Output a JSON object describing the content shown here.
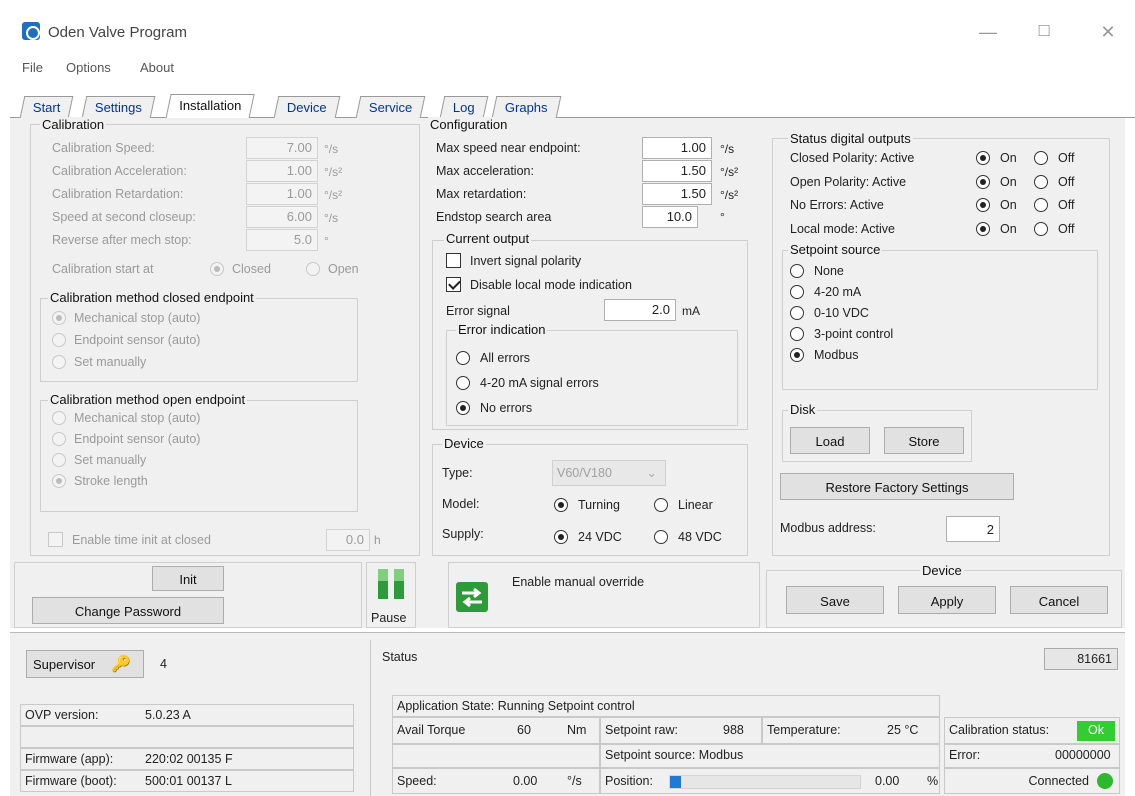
{
  "window": {
    "title": "Oden Valve Program",
    "minimize": "—",
    "maximize": "☐",
    "close": "✕"
  },
  "menu": {
    "file": "File",
    "options": "Options",
    "about": "About"
  },
  "tabs": [
    "Start",
    "Settings",
    "Installation",
    "Device",
    "Service",
    "Log",
    "Graphs"
  ],
  "active_tab": "Installation",
  "calibration": {
    "title": "Calibration",
    "rows": [
      {
        "label": "Calibration Speed:",
        "value": "7.00",
        "unit": "°/s"
      },
      {
        "label": "Calibration Acceleration:",
        "value": "1.00",
        "unit": "°/s²"
      },
      {
        "label": "Calibration Retardation:",
        "value": "1.00",
        "unit": "°/s²"
      },
      {
        "label": "Speed at second closeup:",
        "value": "6.00",
        "unit": "°/s"
      },
      {
        "label": "Reverse after mech stop:",
        "value": "5.0",
        "unit": "°"
      }
    ],
    "start_at_label": "Calibration start at",
    "start_closed": "Closed",
    "start_open": "Open",
    "closed_method_title": "Calibration method closed endpoint",
    "closed_methods": [
      "Mechanical stop (auto)",
      "Endpoint sensor (auto)",
      "Set manually"
    ],
    "open_method_title": "Calibration method open endpoint",
    "open_methods": [
      "Mechanical stop (auto)",
      "Endpoint sensor (auto)",
      "Set manually",
      "Stroke length"
    ],
    "time_init_label": "Enable time init at closed",
    "time_init_value": "0.0",
    "time_init_unit": "h"
  },
  "configuration": {
    "title": "Configuration",
    "rows": [
      {
        "label": "Max speed near endpoint:",
        "value": "1.00",
        "unit": "°/s"
      },
      {
        "label": "Max acceleration:",
        "value": "1.50",
        "unit": "°/s²"
      },
      {
        "label": "Max retardation:",
        "value": "1.50",
        "unit": "°/s²"
      },
      {
        "label": "Endstop search area",
        "value": "10.0",
        "unit": "°"
      }
    ],
    "current_output_title": "Current output",
    "invert_label": "Invert signal polarity",
    "disable_local_label": "Disable local mode indication",
    "error_signal_label": "Error signal",
    "error_signal_value": "2.0",
    "error_signal_unit": "mA",
    "error_indication_title": "Error indication",
    "error_options": [
      "All errors",
      "4-20 mA signal errors",
      "No errors"
    ],
    "device_title": "Device",
    "type_label": "Type:",
    "type_value": "V60/V180",
    "model_label": "Model:",
    "model_turning": "Turning",
    "model_linear": "Linear",
    "supply_label": "Supply:",
    "supply_24": "24 VDC",
    "supply_48": "48 VDC"
  },
  "status_outputs": {
    "title": "Status digital outputs",
    "rows": [
      "Closed Polarity: Active",
      "Open Polarity: Active",
      "No Errors: Active",
      "Local mode: Active"
    ],
    "on": "On",
    "off": "Off"
  },
  "setpoint_source": {
    "title": "Setpoint source",
    "options": [
      "None",
      "4-20 mA",
      "0-10 VDC",
      "3-point control",
      "Modbus"
    ]
  },
  "disk": {
    "title": "Disk",
    "load": "Load",
    "store": "Store"
  },
  "restore_label": "Restore Factory Settings",
  "modbus": {
    "label": "Modbus address:",
    "value": "2"
  },
  "actions": {
    "init": "Init",
    "change_password": "Change Password",
    "pause": "Pause",
    "manual_override": "Enable manual override",
    "device_title": "Device",
    "save": "Save",
    "apply": "Apply",
    "cancel": "Cancel"
  },
  "status_bar": {
    "supervisor": "Supervisor",
    "supervisor_level": "4",
    "ovp_label": "OVP version:",
    "ovp_value": "5.0.23 A",
    "fw_app_label": "Firmware (app):",
    "fw_app_value": "220:02 00135 F",
    "fw_boot_label": "Firmware (boot):",
    "fw_boot_value": "500:01 00137 L",
    "status_title": "Status",
    "counter": "81661",
    "app_state": "Application State:  Running Setpoint control",
    "avail_torque_label": "Avail Torque",
    "avail_torque_value": "60",
    "avail_torque_unit": "Nm",
    "setpoint_raw_label": "Setpoint raw:",
    "setpoint_raw_value": "988",
    "temperature_label": "Temperature:",
    "temperature_value": "25 °C",
    "calib_status_label": "Calibration status:",
    "calib_status_value": "Ok",
    "setpoint_source": "Setpoint source:  Modbus",
    "error_label": "Error:",
    "error_value": "00000000",
    "speed_label": "Speed:",
    "speed_value": "0.00",
    "speed_unit": "°/s",
    "position_label": "Position:",
    "position_value": "0.00",
    "position_unit": "%",
    "position_fill_fraction": 0.06,
    "connected": "Connected",
    "ok_color": "#33cc33",
    "connected_color": "#2db82d"
  }
}
